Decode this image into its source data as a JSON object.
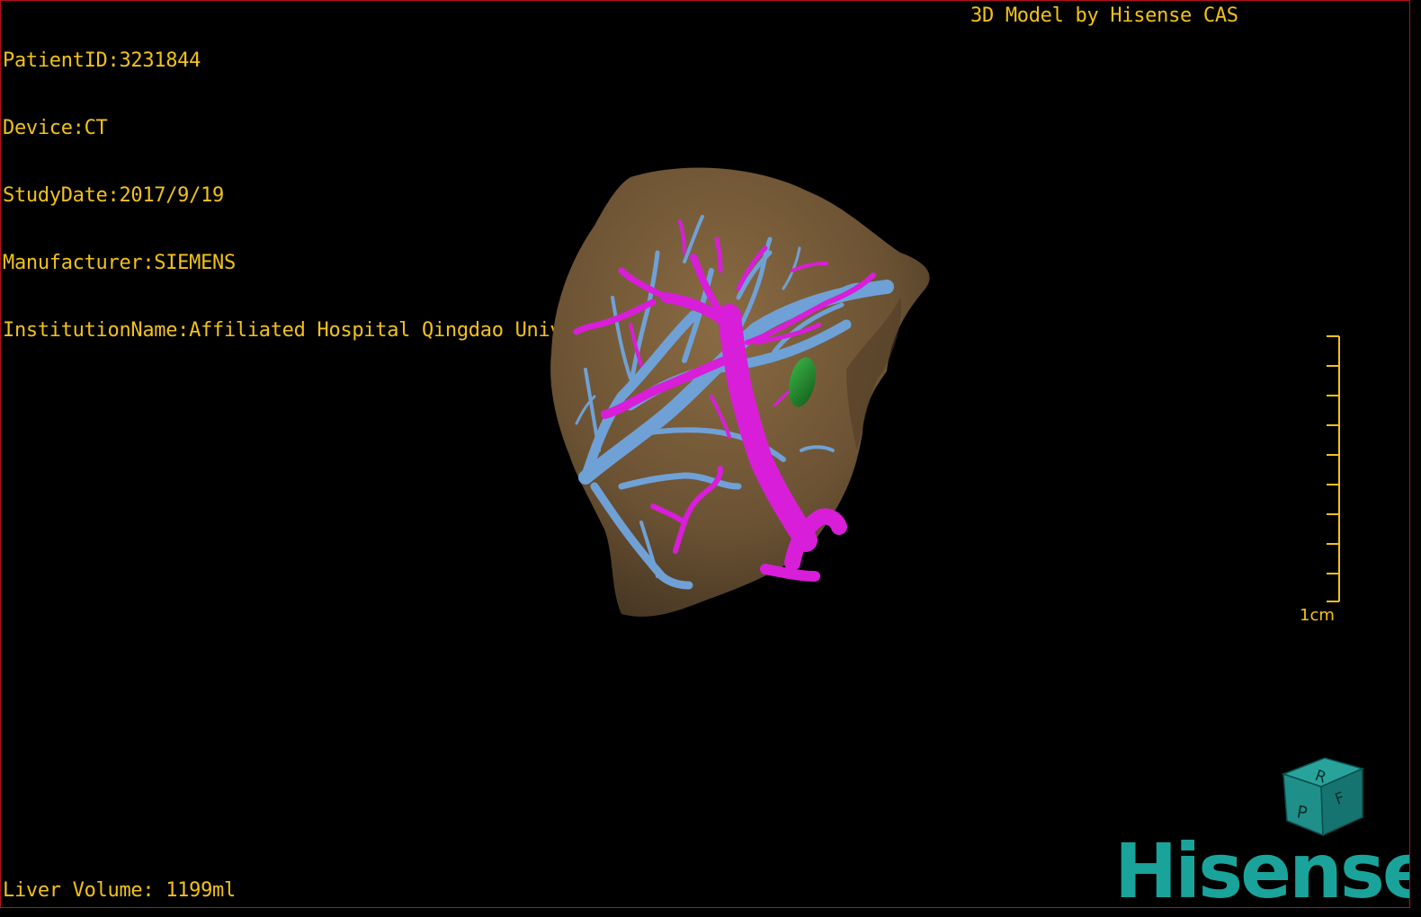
{
  "patient_info": {
    "patient_id": "PatientID:3231844",
    "device": "Device:CT",
    "study_date": "StudyDate:2017/9/19",
    "manufacturer": "Manufacturer:SIEMENS",
    "institution": "InstitutionName:Affiliated Hospital Qingdao University-C"
  },
  "model_credit": "3D Model by Hisense CAS",
  "liver_volume": "Liver Volume: 1199ml",
  "scale_bar": {
    "label": "1cm"
  },
  "orientation_cube": {
    "faces": [
      "R",
      "P",
      "F"
    ],
    "color": "#1f8f8a"
  },
  "brand_logo": "Hisense",
  "colors": {
    "overlay_text": "#f2c21a",
    "liver": "#6b5233",
    "hepatic_vein": "#6fa1d6",
    "portal_vein": "#d81ed8",
    "lesion": "#1f8c2a",
    "brand": "#1aa39a",
    "frame": "#b3101a"
  }
}
